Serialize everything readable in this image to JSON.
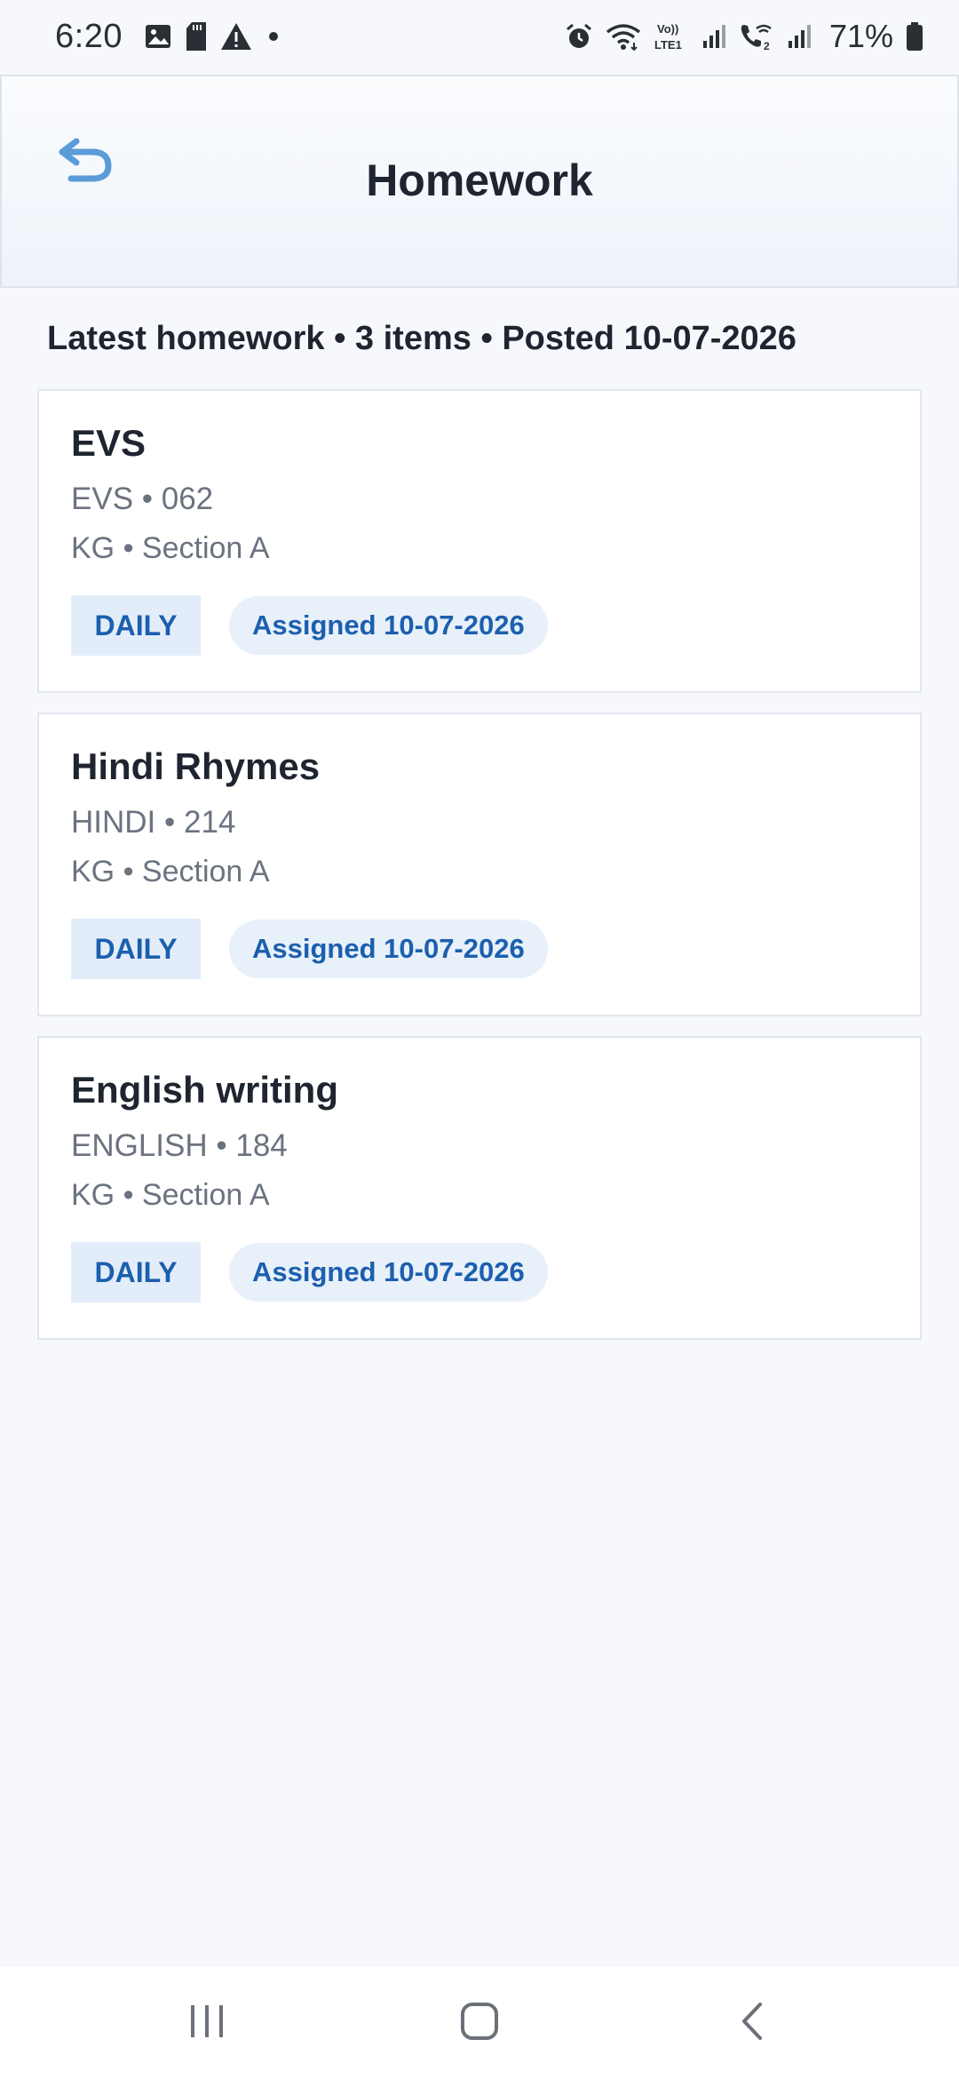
{
  "status_bar": {
    "time": "6:20",
    "battery": "71%",
    "left_icons": [
      "image-icon",
      "sd-card-icon",
      "warning-icon",
      "dot-icon"
    ],
    "right_icons": [
      "alarm-icon",
      "wifi-icon",
      "volte-icon",
      "signal-icon",
      "wifi-calling-icon",
      "signal-icon",
      "battery-icon"
    ],
    "volte_label": "Vo)) LTE1"
  },
  "header": {
    "title": "Homework",
    "back_icon": "back-arrow-icon",
    "accent": "#5b9bd8"
  },
  "summary": {
    "text": "Latest homework • 3 items • Posted 10-07-2026"
  },
  "homework": [
    {
      "title": "EVS",
      "code": "EVS • 062",
      "class": "KG • Section A",
      "frequency": "DAILY",
      "assigned": "Assigned 10-07-2026"
    },
    {
      "title": "Hindi Rhymes",
      "code": "HINDI • 214",
      "class": "KG • Section A",
      "frequency": "DAILY",
      "assigned": "Assigned 10-07-2026"
    },
    {
      "title": "English writing",
      "code": "ENGLISH • 184",
      "class": "KG • Section A",
      "frequency": "DAILY",
      "assigned": "Assigned 10-07-2026"
    }
  ],
  "nav": {
    "items": [
      "recents-icon",
      "home-icon",
      "back-icon"
    ]
  },
  "colors": {
    "background": "#f6f8fc",
    "tag_text": "#1c5fae",
    "tag_bg": "#e3edfa"
  }
}
